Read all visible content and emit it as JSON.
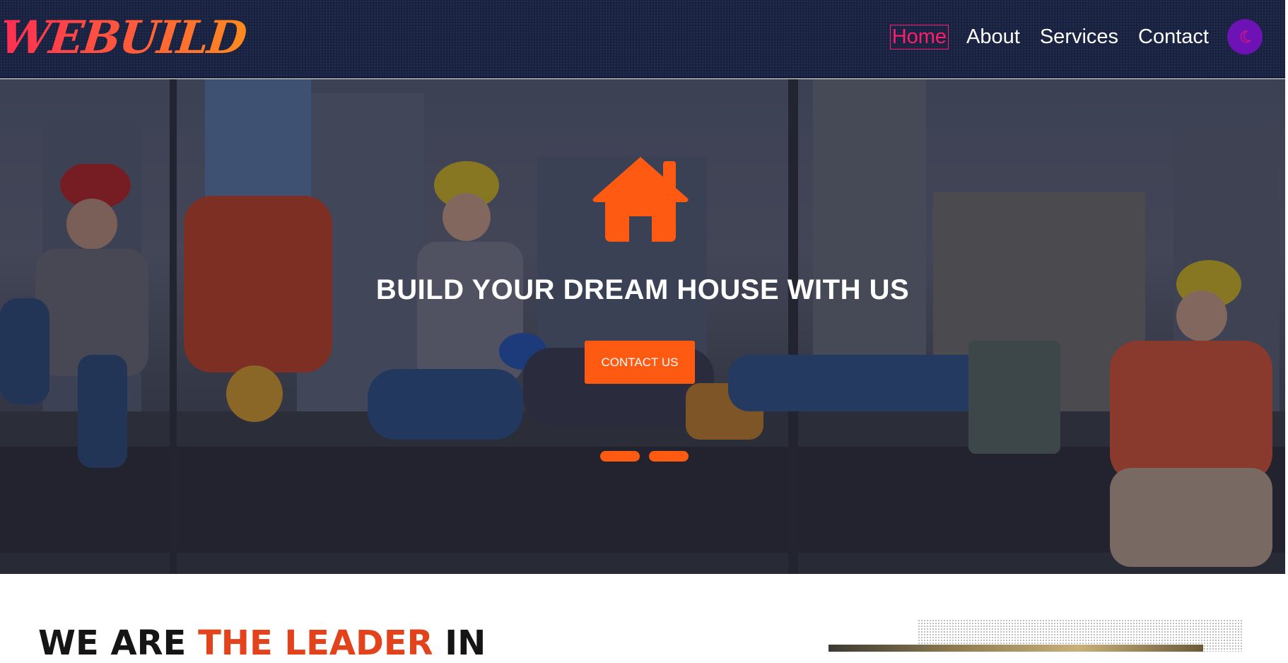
{
  "header": {
    "logo": "WEBUILD",
    "nav": [
      {
        "label": "Home",
        "active": true
      },
      {
        "label": "About",
        "active": false
      },
      {
        "label": "Services",
        "active": false
      },
      {
        "label": "Contact",
        "active": false
      }
    ],
    "theme_toggle_icon": "moon-icon"
  },
  "hero": {
    "icon": "house-icon",
    "title": "BUILD YOUR DREAM HOUSE WITH US",
    "cta_label": "CONTACT US",
    "slide_count": 2
  },
  "about": {
    "heading_start": "WE ARE ",
    "heading_accent": "THE LEADER",
    "heading_end": " IN"
  },
  "colors": {
    "header_bg": "#18213f",
    "accent": "#ff5a12",
    "nav_active": "#ff1d6e",
    "toggle": "#6d12b5",
    "heading_accent": "#e2431c"
  }
}
